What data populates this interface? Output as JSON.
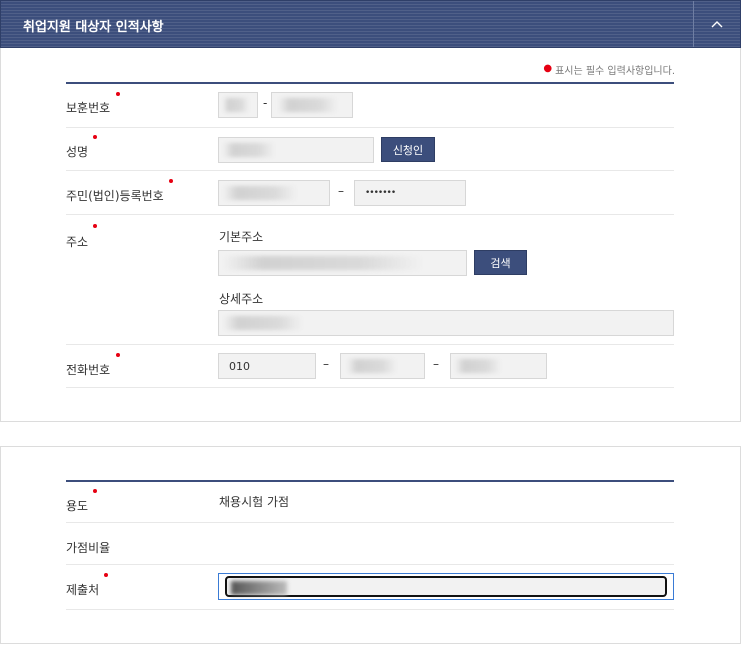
{
  "header": {
    "title": "취업지원 대상자 인적사항"
  },
  "required_note": "표시는 필수 입력사항입니다.",
  "fields": {
    "bohun_label": "보훈번호",
    "bohun_sep": "-",
    "name_label": "성명",
    "applicant_button": "신청인",
    "rrn_label": "주민(법인)등록번호",
    "rrn_sep": "–",
    "rrn_back": "•••••••",
    "address_label": "주소",
    "address_basic_label": "기본주소",
    "search_button": "검색",
    "address_detail_label": "상세주소",
    "phone_label": "전화번호",
    "phone_first": "010",
    "phone_sep": "–"
  },
  "usage": {
    "purpose_label": "용도",
    "purpose_value": "채용시험 가점",
    "ratio_label": "가점비율",
    "submit_label": "제출처"
  }
}
